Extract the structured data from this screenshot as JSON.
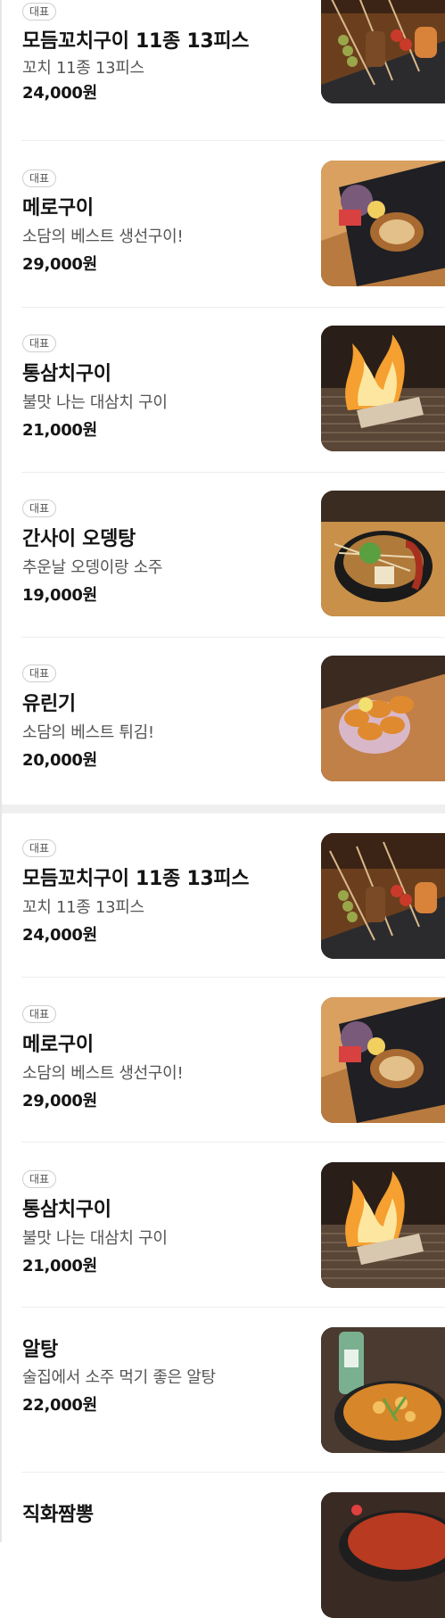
{
  "menu_section_1": [
    {
      "badge": "대표",
      "name": "모듬꼬치구이 11종 13피스",
      "description": "꼬치 11종 13피스",
      "price": "24,000원",
      "photo": "skewer-platter-photo"
    },
    {
      "badge": "대표",
      "name": "메로구이",
      "description": "소담의 베스트 생선구이!",
      "price": "29,000원",
      "photo": "grilled-fish-photo"
    },
    {
      "badge": "대표",
      "name": "통삼치구이",
      "description": "불맛 나는 대삼치 구이",
      "price": "21,000원",
      "photo": "flame-mackerel-photo"
    },
    {
      "badge": "대표",
      "name": "간사이 오뎅탕",
      "description": "추운날 오뎅이랑 소주",
      "price": "19,000원",
      "photo": "oden-soup-photo"
    },
    {
      "badge": "대표",
      "name": "유린기",
      "description": "소담의 베스트 튀김!",
      "price": "20,000원",
      "photo": "fried-chicken-photo"
    }
  ],
  "menu_section_2": [
    {
      "badge": "대표",
      "name": "모듬꼬치구이 11종 13피스",
      "description": "꼬치 11종 13피스",
      "price": "24,000원",
      "photo": "skewer-platter-photo"
    },
    {
      "badge": "대표",
      "name": "메로구이",
      "description": "소담의 베스트 생선구이!",
      "price": "29,000원",
      "photo": "grilled-fish-photo"
    },
    {
      "badge": "대표",
      "name": "통삼치구이",
      "description": "불맛 나는 대삼치 구이",
      "price": "21,000원",
      "photo": "flame-mackerel-photo"
    },
    {
      "badge": "",
      "name": "알탕",
      "description": "술집에서 소주 먹기 좋은 알탕",
      "price": "22,000원",
      "photo": "fish-roe-stew-photo"
    },
    {
      "badge": "",
      "name": "직화짬뽕",
      "description": "",
      "price": "",
      "photo": "jjamppong-photo"
    }
  ],
  "colors": {
    "divider": "#efefef",
    "separator": "#eeeeee",
    "text_primary": "#141414",
    "text_secondary": "#555555"
  }
}
